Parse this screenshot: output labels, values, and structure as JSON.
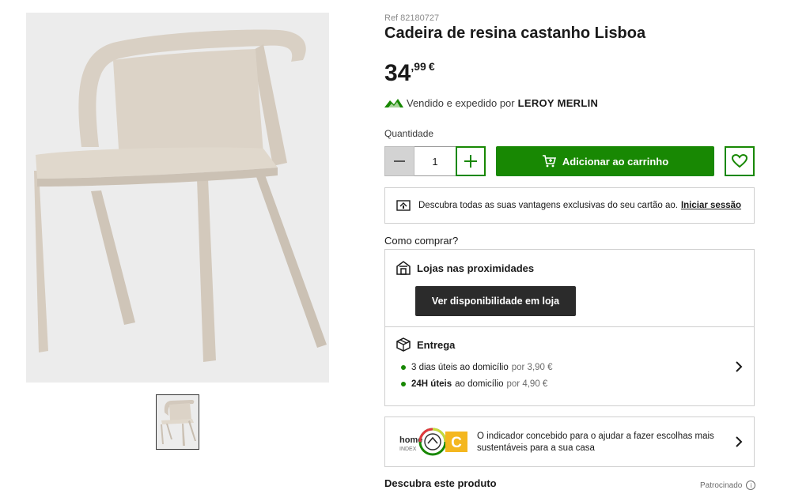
{
  "product": {
    "ref": "Ref 82180727",
    "title": "Cadeira de resina castanho Lisboa",
    "price_int": "34",
    "price_dec": ",99",
    "currency": "€"
  },
  "seller": {
    "prefix": "Vendido e expedido por",
    "name": "LEROY MERLIN"
  },
  "quantity": {
    "label": "Quantidade",
    "value": "1"
  },
  "actions": {
    "add_to_cart": "Adicionar ao carrinho"
  },
  "promo": {
    "text": "Descubra todas as suas vantagens exclusivas do seu cartão ao.",
    "link": "Iniciar sessão"
  },
  "how_to_buy": {
    "title": "Como comprar?",
    "stores_title": "Lojas nas proximidades",
    "availability_button": "Ver disponibilidade em loja",
    "delivery_title": "Entrega",
    "delivery_options": [
      {
        "bold": "",
        "text": "3 dias úteis ao domicílio",
        "price": "por 3,90 €"
      },
      {
        "bold": "24H úteis",
        "text": "ao domicílio",
        "price": "por 4,90 €"
      }
    ]
  },
  "home_index": {
    "logo_word": "home",
    "logo_sub": "INDEX",
    "grade": "C",
    "text": "O indicador concebido para o ajudar a fazer escolhas mais sustentáveis para a sua casa"
  },
  "footer": {
    "discover": "Descubra este produto",
    "sponsored": "Patrocinado",
    "info_glyph": "i"
  },
  "colors": {
    "brand_green": "#188803",
    "dark_button": "#2b2b2b",
    "chair_color": "#d8cfc3",
    "grade_orange": "#f4b71f"
  }
}
